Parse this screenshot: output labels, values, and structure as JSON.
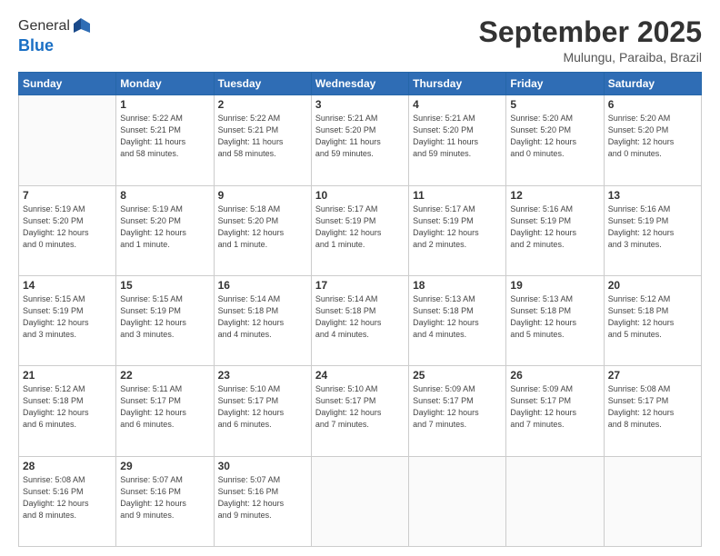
{
  "logo": {
    "general": "General",
    "blue": "Blue"
  },
  "header": {
    "month": "September 2025",
    "location": "Mulungu, Paraiba, Brazil"
  },
  "weekdays": [
    "Sunday",
    "Monday",
    "Tuesday",
    "Wednesday",
    "Thursday",
    "Friday",
    "Saturday"
  ],
  "weeks": [
    [
      {
        "day": "",
        "info": ""
      },
      {
        "day": "1",
        "info": "Sunrise: 5:22 AM\nSunset: 5:21 PM\nDaylight: 11 hours\nand 58 minutes."
      },
      {
        "day": "2",
        "info": "Sunrise: 5:22 AM\nSunset: 5:21 PM\nDaylight: 11 hours\nand 58 minutes."
      },
      {
        "day": "3",
        "info": "Sunrise: 5:21 AM\nSunset: 5:20 PM\nDaylight: 11 hours\nand 59 minutes."
      },
      {
        "day": "4",
        "info": "Sunrise: 5:21 AM\nSunset: 5:20 PM\nDaylight: 11 hours\nand 59 minutes."
      },
      {
        "day": "5",
        "info": "Sunrise: 5:20 AM\nSunset: 5:20 PM\nDaylight: 12 hours\nand 0 minutes."
      },
      {
        "day": "6",
        "info": "Sunrise: 5:20 AM\nSunset: 5:20 PM\nDaylight: 12 hours\nand 0 minutes."
      }
    ],
    [
      {
        "day": "7",
        "info": "Sunrise: 5:19 AM\nSunset: 5:20 PM\nDaylight: 12 hours\nand 0 minutes."
      },
      {
        "day": "8",
        "info": "Sunrise: 5:19 AM\nSunset: 5:20 PM\nDaylight: 12 hours\nand 1 minute."
      },
      {
        "day": "9",
        "info": "Sunrise: 5:18 AM\nSunset: 5:20 PM\nDaylight: 12 hours\nand 1 minute."
      },
      {
        "day": "10",
        "info": "Sunrise: 5:17 AM\nSunset: 5:19 PM\nDaylight: 12 hours\nand 1 minute."
      },
      {
        "day": "11",
        "info": "Sunrise: 5:17 AM\nSunset: 5:19 PM\nDaylight: 12 hours\nand 2 minutes."
      },
      {
        "day": "12",
        "info": "Sunrise: 5:16 AM\nSunset: 5:19 PM\nDaylight: 12 hours\nand 2 minutes."
      },
      {
        "day": "13",
        "info": "Sunrise: 5:16 AM\nSunset: 5:19 PM\nDaylight: 12 hours\nand 3 minutes."
      }
    ],
    [
      {
        "day": "14",
        "info": "Sunrise: 5:15 AM\nSunset: 5:19 PM\nDaylight: 12 hours\nand 3 minutes."
      },
      {
        "day": "15",
        "info": "Sunrise: 5:15 AM\nSunset: 5:19 PM\nDaylight: 12 hours\nand 3 minutes."
      },
      {
        "day": "16",
        "info": "Sunrise: 5:14 AM\nSunset: 5:18 PM\nDaylight: 12 hours\nand 4 minutes."
      },
      {
        "day": "17",
        "info": "Sunrise: 5:14 AM\nSunset: 5:18 PM\nDaylight: 12 hours\nand 4 minutes."
      },
      {
        "day": "18",
        "info": "Sunrise: 5:13 AM\nSunset: 5:18 PM\nDaylight: 12 hours\nand 4 minutes."
      },
      {
        "day": "19",
        "info": "Sunrise: 5:13 AM\nSunset: 5:18 PM\nDaylight: 12 hours\nand 5 minutes."
      },
      {
        "day": "20",
        "info": "Sunrise: 5:12 AM\nSunset: 5:18 PM\nDaylight: 12 hours\nand 5 minutes."
      }
    ],
    [
      {
        "day": "21",
        "info": "Sunrise: 5:12 AM\nSunset: 5:18 PM\nDaylight: 12 hours\nand 6 minutes."
      },
      {
        "day": "22",
        "info": "Sunrise: 5:11 AM\nSunset: 5:17 PM\nDaylight: 12 hours\nand 6 minutes."
      },
      {
        "day": "23",
        "info": "Sunrise: 5:10 AM\nSunset: 5:17 PM\nDaylight: 12 hours\nand 6 minutes."
      },
      {
        "day": "24",
        "info": "Sunrise: 5:10 AM\nSunset: 5:17 PM\nDaylight: 12 hours\nand 7 minutes."
      },
      {
        "day": "25",
        "info": "Sunrise: 5:09 AM\nSunset: 5:17 PM\nDaylight: 12 hours\nand 7 minutes."
      },
      {
        "day": "26",
        "info": "Sunrise: 5:09 AM\nSunset: 5:17 PM\nDaylight: 12 hours\nand 7 minutes."
      },
      {
        "day": "27",
        "info": "Sunrise: 5:08 AM\nSunset: 5:17 PM\nDaylight: 12 hours\nand 8 minutes."
      }
    ],
    [
      {
        "day": "28",
        "info": "Sunrise: 5:08 AM\nSunset: 5:16 PM\nDaylight: 12 hours\nand 8 minutes."
      },
      {
        "day": "29",
        "info": "Sunrise: 5:07 AM\nSunset: 5:16 PM\nDaylight: 12 hours\nand 9 minutes."
      },
      {
        "day": "30",
        "info": "Sunrise: 5:07 AM\nSunset: 5:16 PM\nDaylight: 12 hours\nand 9 minutes."
      },
      {
        "day": "",
        "info": ""
      },
      {
        "day": "",
        "info": ""
      },
      {
        "day": "",
        "info": ""
      },
      {
        "day": "",
        "info": ""
      }
    ]
  ]
}
